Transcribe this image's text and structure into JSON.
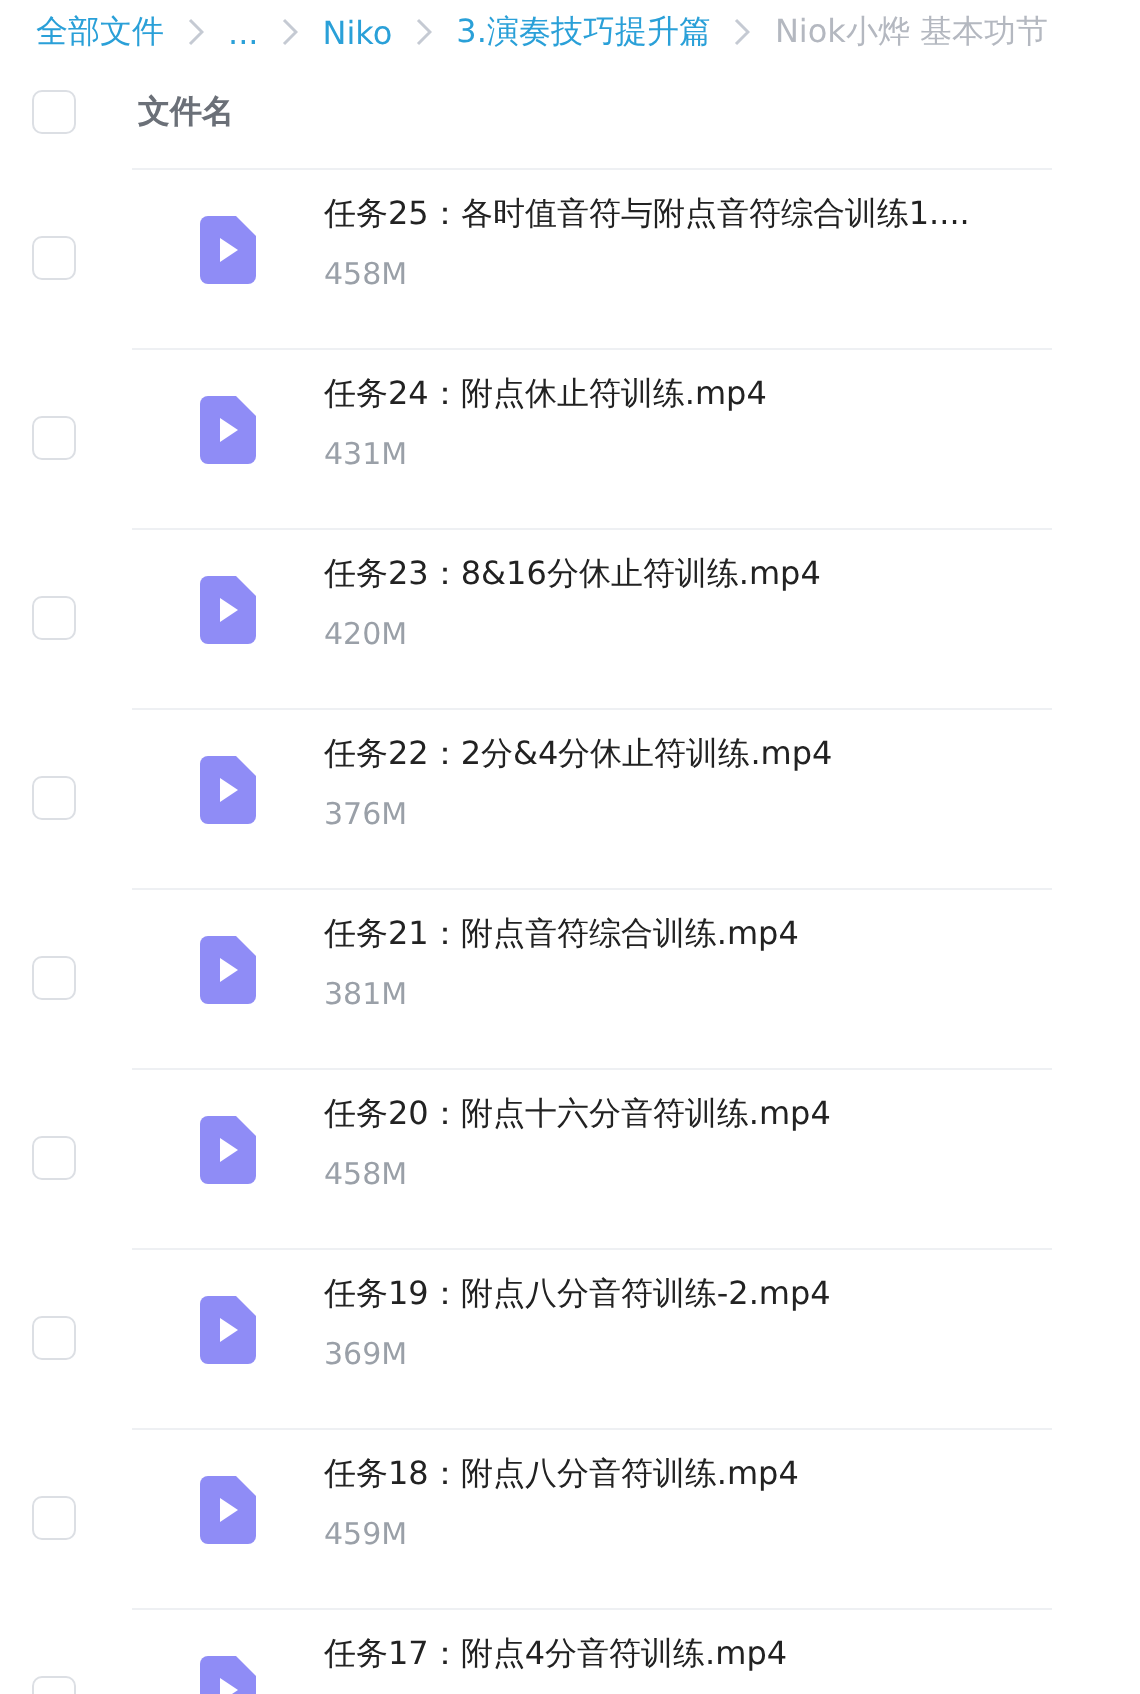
{
  "breadcrumb": [
    {
      "label": "全部文件",
      "current": false
    },
    {
      "label": "...",
      "current": false
    },
    {
      "label": "Niko",
      "current": false
    },
    {
      "label": "3.演奏技巧提升篇",
      "current": false
    },
    {
      "label": "Niok小烨 基本功节",
      "current": true
    }
  ],
  "header": {
    "checked": false,
    "column": "文件名"
  },
  "files": [
    {
      "name": "任务25：各时值音符与附点音符综合训练1....",
      "size": "458M",
      "checked": false
    },
    {
      "name": "任务24：附点休止符训练.mp4",
      "size": "431M",
      "checked": false
    },
    {
      "name": "任务23：8&16分休止符训练.mp4",
      "size": "420M",
      "checked": false
    },
    {
      "name": "任务22：2分&4分休止符训练.mp4",
      "size": "376M",
      "checked": false
    },
    {
      "name": "任务21：附点音符综合训练.mp4",
      "size": "381M",
      "checked": false
    },
    {
      "name": "任务20：附点十六分音符训练.mp4",
      "size": "458M",
      "checked": false
    },
    {
      "name": "任务19：附点八分音符训练-2.mp4",
      "size": "369M",
      "checked": false
    },
    {
      "name": "任务18：附点八分音符训练.mp4",
      "size": "459M",
      "checked": false
    },
    {
      "name": "任务17：附点4分音符训练.mp4",
      "checked": false
    }
  ]
}
